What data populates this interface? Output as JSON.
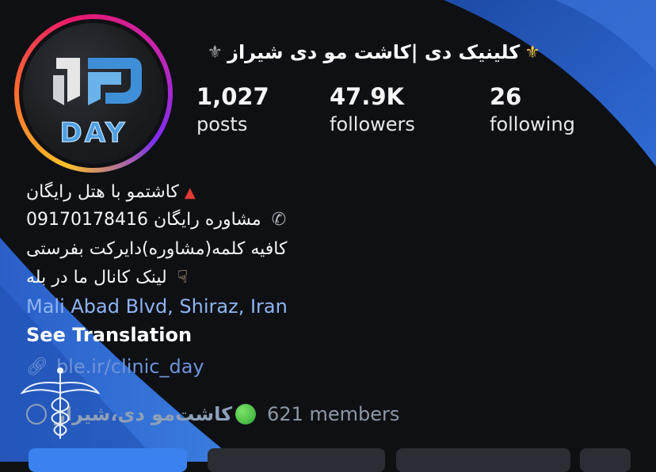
{
  "profile": {
    "title": "کلینیک دی |کاشت مو دی شیراز",
    "title_icon": "fleur-de-lis-icon",
    "avatar_logo_text": "DAY"
  },
  "stats": [
    {
      "value": "1,027",
      "label": "posts"
    },
    {
      "value": "47.9K",
      "label": "followers"
    },
    {
      "value": "26",
      "label": "following"
    }
  ],
  "bio": {
    "line1": "کاشتمو با هتل رایگان",
    "line1_icon": "red-triangle-icon",
    "line2": "مشاوره رایگان 09170178416",
    "line2_icon": "phone-icon",
    "line3": "کافیه کلمه(مشاوره)دایرکت بفرستی",
    "line4": "لینک کانال ما در بله",
    "line4_icon": "pointing-down-hand-icon",
    "location": "Mali Abad Blvd, Shiraz, Iran",
    "see_translation": "See Translation",
    "link": "ble.ir/clinic_day",
    "channel_name": "کاشت‌مو دی،شیراز",
    "members": "621 members"
  },
  "colors": {
    "accent_blue": "#2f6bd4",
    "link_blue": "#6f93d8",
    "location_blue": "#8fb4f2",
    "background": "#0e1014",
    "logo_blue": "#4f9fe0"
  }
}
